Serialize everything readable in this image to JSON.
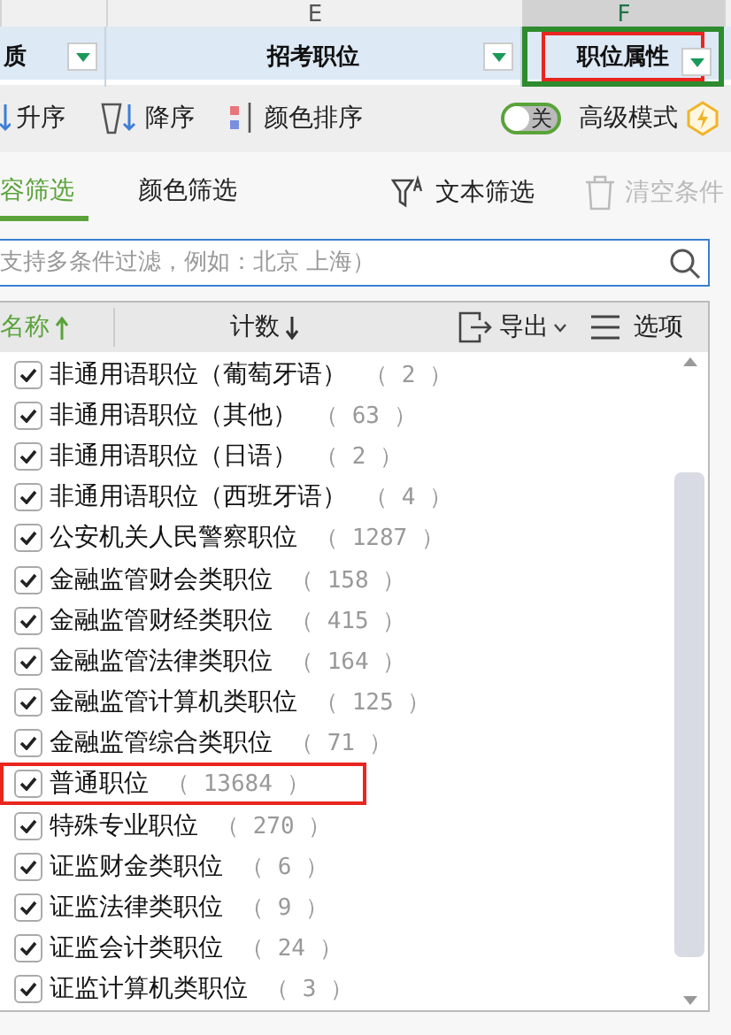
{
  "column_letters": [
    {
      "label": "E",
      "selected": false
    },
    {
      "label": "F",
      "selected": true
    }
  ],
  "header_cells": [
    {
      "label": "质",
      "selected": false,
      "highlighted": false
    },
    {
      "label": "招考职位",
      "selected": false,
      "highlighted": false
    },
    {
      "label": "职位属性",
      "selected": true,
      "highlighted": true
    }
  ],
  "sort_toolbar": {
    "ascending": "升序",
    "descending": "降序",
    "color_sort": "颜色排序",
    "advanced_toggle": {
      "label": "关",
      "on": false
    },
    "advanced_mode": "高级模式"
  },
  "filter_tabs": [
    {
      "label": "容筛选",
      "selected": true
    },
    {
      "label": "颜色筛选",
      "selected": false
    }
  ],
  "text_filter": "文本筛选",
  "clear_conditions": {
    "label": "清空条件",
    "disabled": true
  },
  "search": {
    "placeholder": "支持多条件过滤，例如：北京 上海）"
  },
  "list_header": {
    "name": "名称",
    "count": "计数",
    "export": "导出",
    "options": "选项"
  },
  "items": [
    {
      "name": "非通用语职位（葡萄牙语）",
      "count": "（ 2 ）",
      "checked": true,
      "highlighted": false
    },
    {
      "name": "非通用语职位（其他）",
      "count": "（ 63 ）",
      "checked": true,
      "highlighted": false
    },
    {
      "name": "非通用语职位（日语）",
      "count": "（ 2 ）",
      "checked": true,
      "highlighted": false
    },
    {
      "name": "非通用语职位（西班牙语）",
      "count": "（ 4 ）",
      "checked": true,
      "highlighted": false
    },
    {
      "name": "公安机关人民警察职位",
      "count": "（ 1287 ）",
      "checked": true,
      "highlighted": false
    },
    {
      "name": "金融监管财会类职位",
      "count": "（ 158 ）",
      "checked": true,
      "highlighted": false
    },
    {
      "name": "金融监管财经类职位",
      "count": "（ 415 ）",
      "checked": true,
      "highlighted": false
    },
    {
      "name": "金融监管法律类职位",
      "count": "（ 164 ）",
      "checked": true,
      "highlighted": false
    },
    {
      "name": "金融监管计算机类职位",
      "count": "（ 125 ）",
      "checked": true,
      "highlighted": false
    },
    {
      "name": "金融监管综合类职位",
      "count": "（ 71 ）",
      "checked": true,
      "highlighted": false
    },
    {
      "name": "普通职位",
      "count": "（ 13684 ）",
      "checked": true,
      "highlighted": true
    },
    {
      "name": "特殊专业职位",
      "count": "（ 270 ）",
      "checked": true,
      "highlighted": false
    },
    {
      "name": "证监财金类职位",
      "count": "（ 6 ）",
      "checked": true,
      "highlighted": false
    },
    {
      "name": "证监法律类职位",
      "count": "（ 9 ）",
      "checked": true,
      "highlighted": false
    },
    {
      "name": "证监会计类职位",
      "count": "（ 24 ）",
      "checked": true,
      "highlighted": false
    },
    {
      "name": "证监计算机类职位",
      "count": "（ 3 ）",
      "checked": true,
      "highlighted": false
    }
  ]
}
